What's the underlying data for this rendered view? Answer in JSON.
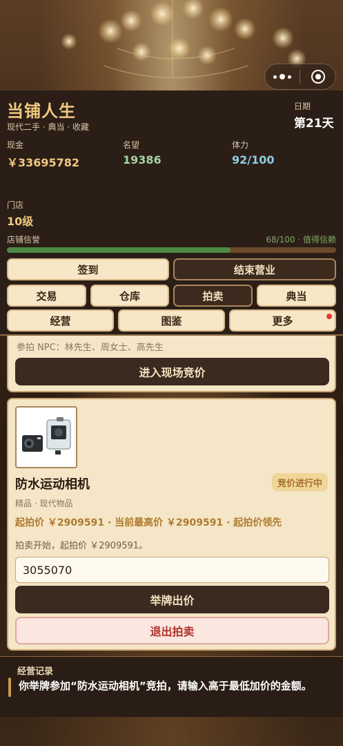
{
  "header": {
    "title": "当铺人生",
    "subtitle": "现代二手 · 典当 · 收藏",
    "date_label": "日期",
    "date_value": "第21天"
  },
  "stats": [
    {
      "label": "现金",
      "value": "￥33695782",
      "color": "#f0c880"
    },
    {
      "label": "名望",
      "value": "19386",
      "color": "#a6d3a0"
    },
    {
      "label": "体力",
      "value": "92/100",
      "color": "#8ecde0"
    }
  ],
  "shop": {
    "label": "门店",
    "level": "10级",
    "reputation_label": "店铺信誉",
    "reputation_status": "68/100 · 值得信赖",
    "reputation_value": 68,
    "reputation_max": 100
  },
  "actions": {
    "checkin": "签到",
    "close_shop": "结束营业",
    "trade": "交易",
    "warehouse": "仓库",
    "auction": "拍卖",
    "pawn": "典当",
    "manage": "经营",
    "catalog": "图鉴",
    "more": "更多"
  },
  "live_auction": {
    "npc_text": "参拍 NPC：林先生、周女士、高先生",
    "enter_button": "进入现场竞价"
  },
  "auction_item": {
    "name": "防水运动相机",
    "status_badge": "竞价进行中",
    "category": "精品 · 现代物品",
    "price_line": "起拍价 ￥2909591 · 当前最高价 ￥2909591 · 起拍价领先",
    "message": "拍卖开始，起拍价 ￥2909591。",
    "bid_value": "3055070",
    "bid_button": "举牌出价",
    "exit_button": "退出拍卖",
    "image_icon": "action-camera-icon"
  },
  "log": {
    "title": "经营记录",
    "text": "你举牌参加“防水运动相机”竞拍，请输入高于最低加价的金额。"
  },
  "colors": {
    "accent_gold": "#f0c880",
    "panel_bg": "#f4e6c6",
    "dark_button": "#3a2a1f",
    "reputation_fill": "#4e8a45",
    "notification_dot": "#e53935"
  }
}
